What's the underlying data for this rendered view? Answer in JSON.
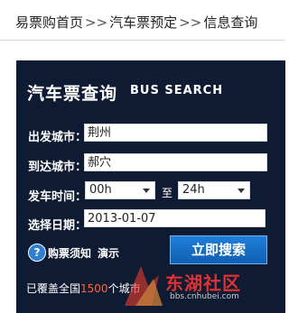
{
  "breadcrumb": {
    "home": "易票购首页",
    "sep1": ">>",
    "bus": "汽车票预定",
    "sep2": ">>",
    "info": "信息查询"
  },
  "panel": {
    "title_cn": "汽车票查询",
    "title_en": "BUS SEARCH",
    "depart_label": "出发城市：",
    "depart_value": "荆州",
    "arrive_label": "到达城市：",
    "arrive_value": "郝穴",
    "time_label": "发车时间：",
    "time_from": "00h",
    "time_to_label": "至",
    "time_to": "24h",
    "date_label": "选择日期：",
    "date_value": "2013-01-07",
    "help_icon_glyph": "?",
    "help_text": "购票须知",
    "demo_text": "演示",
    "search_button": "立即搜索",
    "coverage_prefix": "已覆盖全国",
    "coverage_number": "1500",
    "coverage_suffix": "个城市",
    "watermark_logo": "东湖社区",
    "watermark_url": "bbs.cnhubei.com"
  },
  "colors": {
    "panel_bg": "#0f1b33",
    "button": "#1f7fd8",
    "highlight": "#ff6633"
  }
}
